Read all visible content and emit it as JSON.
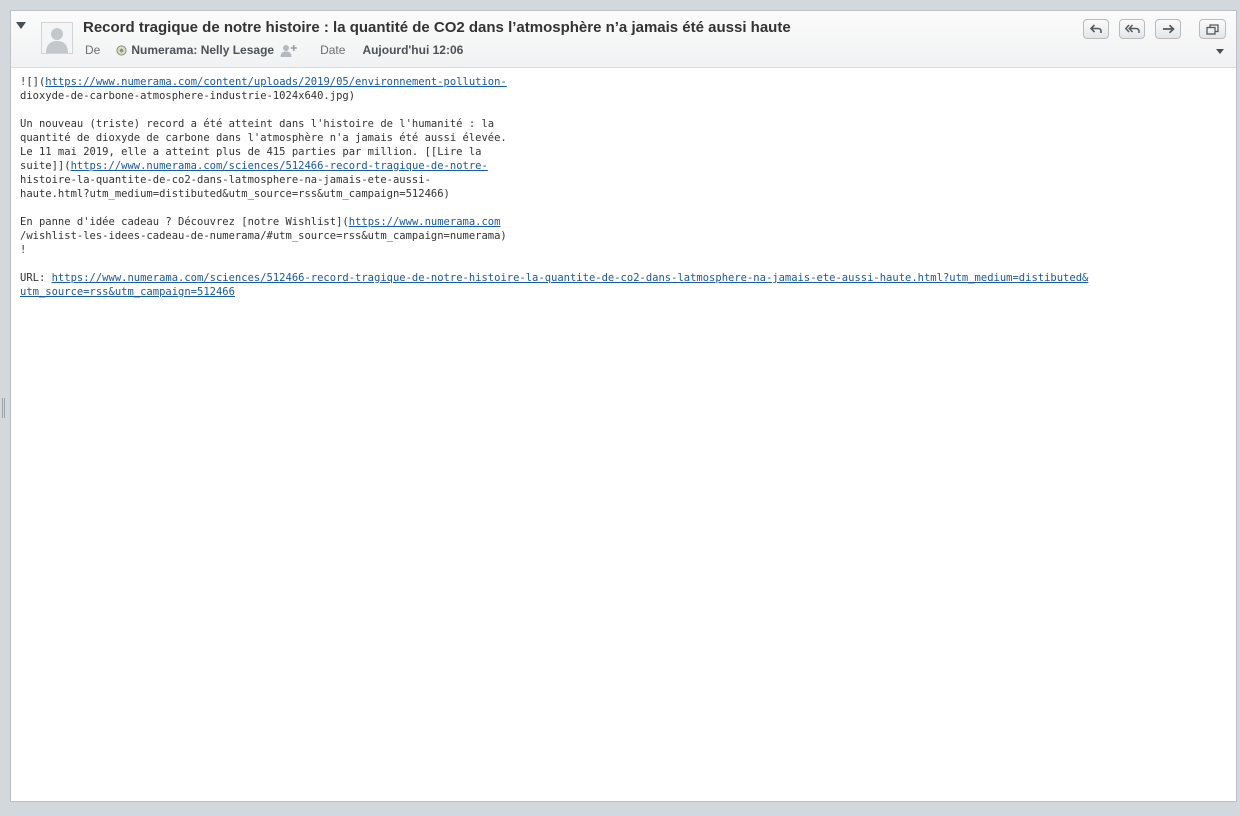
{
  "message": {
    "subject": "Record tragique de notre histoire : la quantité de CO2 dans l’atmosphère n’a jamais été aussi haute",
    "from_label": "De",
    "sender_name": "Numerama: Nelly Lesage",
    "date_label": "Date",
    "date_value": "Aujourd'hui 12:06"
  },
  "toolbar": {
    "reply_icon": "reply-icon",
    "reply_all_icon": "reply-all-icon",
    "forward_icon": "forward-icon",
    "new_window_icon": "new-window-icon"
  },
  "colors": {
    "link": "#1a5aa0",
    "text": "#333333",
    "header_bg": "#f4f5f6",
    "frame_bg": "#d3d8dd"
  },
  "body": {
    "l1_pre": "![](",
    "l1_link": "https://www.numerama.com/content/uploads/2019/05/environnement-pollution-",
    "l2": "dioxyde-de-carbone-atmosphere-industrie-1024x640.jpg)",
    "l4": "Un nouveau (triste) record a été atteint dans l'histoire de l'humanité : la",
    "l5": "quantité de dioxyde de carbone dans l'atmosphère n'a jamais été aussi élevée.",
    "l6": "Le 11 mai 2019, elle a atteint plus de 415 parties par million. [[Lire la",
    "l7_pre": "suite]](",
    "l7_link": "https://www.numerama.com/sciences/512466-record-tragique-de-notre-",
    "l8": "histoire-la-quantite-de-co2-dans-latmosphere-na-jamais-ete-aussi-",
    "l9": "haute.html?utm_medium=distibuted&utm_source=rss&utm_campaign=512466)",
    "l11_pre": "En panne d'idée cadeau ? Découvrez [notre Wishlist](",
    "l11_link": "https://www.numerama.com",
    "l12": "/wishlist-les-idees-cadeau-de-numerama/#utm_source=rss&utm_campaign=numerama)",
    "l13": "!",
    "l15_pre": "URL: ",
    "l15_link": "https://www.numerama.com/sciences/512466-record-tragique-de-notre-histoire-la-quantite-de-co2-dans-latmosphere-na-jamais-ete-aussi-haute.html?utm_medium=distibuted&",
    "l16_link": "utm_source=rss&utm_campaign=512466"
  }
}
